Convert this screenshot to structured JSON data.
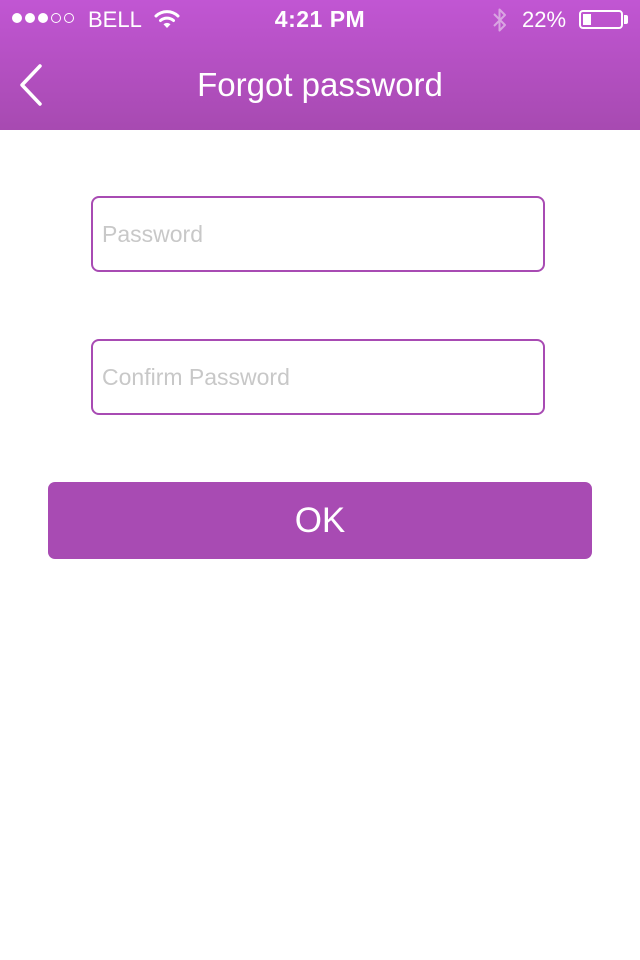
{
  "status_bar": {
    "carrier": "BELL",
    "time": "4:21 PM",
    "battery_percent": "22%",
    "battery_level": 0.22,
    "signal_strength": 3,
    "signal_max": 5,
    "icons": [
      "signal-dots-icon",
      "wifi-icon",
      "bluetooth-icon",
      "battery-icon"
    ]
  },
  "nav": {
    "title": "Forgot password",
    "back_icon": "chevron-left-icon"
  },
  "form": {
    "password_placeholder": "Password",
    "password_value": "",
    "confirm_placeholder": "Confirm Password",
    "confirm_value": "",
    "ok_label": "OK"
  },
  "colors": {
    "accent": "#a84bb3",
    "header_top": "#c156d3",
    "header_bottom": "#a74ab1",
    "placeholder": "#c8c8c8"
  }
}
